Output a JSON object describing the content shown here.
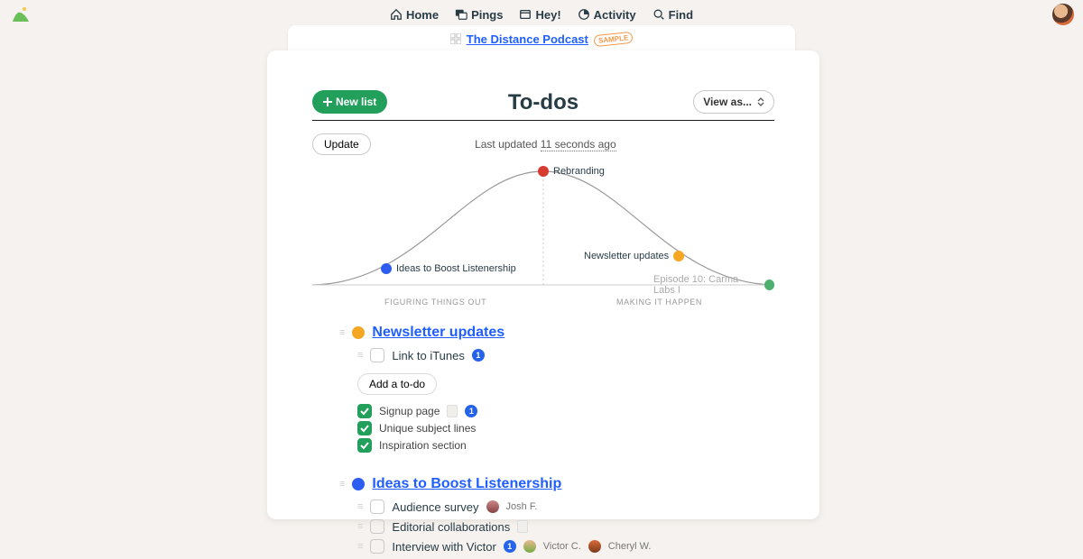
{
  "nav": {
    "items": [
      {
        "label": "Home"
      },
      {
        "label": "Pings"
      },
      {
        "label": "Hey!"
      },
      {
        "label": "Activity"
      },
      {
        "label": "Find"
      }
    ]
  },
  "breadcrumb": {
    "project_name": "The Distance Podcast",
    "badge": "SAMPLE"
  },
  "header": {
    "title": "To-dos",
    "new_list_label": "New list",
    "view_as_label": "View as..."
  },
  "status": {
    "update_label": "Update",
    "last_updated_prefix": "Last updated ",
    "last_updated_value": "11 seconds ago"
  },
  "hill": {
    "left_label": "FIGURING THINGS OUT",
    "right_label": "MAKING IT HAPPEN",
    "colors": {
      "rebranding": "#d73a2f",
      "ideas": "#2d5cf0",
      "newsletter": "#f5a623",
      "episode": "#4db06e"
    },
    "markers": {
      "rebranding": "Rebranding",
      "ideas": "Ideas to Boost Listenership",
      "newsletter": "Newsletter updates",
      "episode": "Episode 10: Carma Labs I"
    }
  },
  "sections": [
    {
      "id": "newsletter",
      "title": "Newsletter updates",
      "dot_color": "#f5a623",
      "open_items": [
        {
          "title": "Link to iTunes",
          "badge": 1
        }
      ],
      "add_button": "Add a to-do",
      "done_items": [
        {
          "title": "Signup page",
          "doc": true,
          "badge": 1
        },
        {
          "title": "Unique subject lines"
        },
        {
          "title": "Inspiration section"
        }
      ]
    },
    {
      "id": "ideas",
      "title": "Ideas to Boost Listenership",
      "dot_color": "#2d5cf0",
      "open_items": [
        {
          "title": "Audience survey",
          "assignees": [
            {
              "name": "Josh F.",
              "av": "josh"
            }
          ]
        },
        {
          "title": "Editorial collaborations",
          "doc": true
        },
        {
          "title": "Interview with Victor",
          "badge": 1,
          "assignees": [
            {
              "name": "Victor C.",
              "av": "victor"
            },
            {
              "name": "Cheryl W.",
              "av": "cheryl"
            }
          ]
        }
      ]
    }
  ]
}
